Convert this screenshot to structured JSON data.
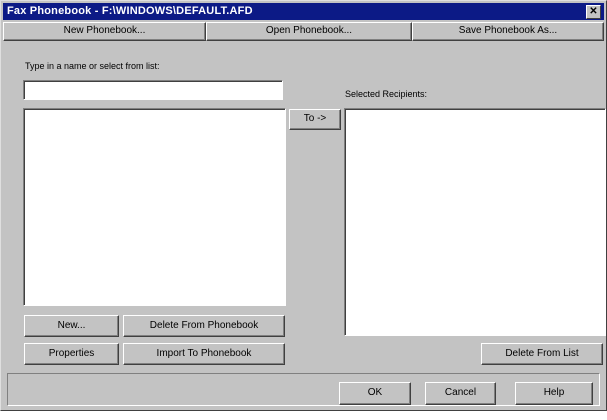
{
  "window": {
    "title": "Fax Phonebook - F:\\WINDOWS\\DEFAULT.AFD",
    "close_glyph": "✕"
  },
  "toolbar": {
    "new_phonebook": "New Phonebook...",
    "open_phonebook": "Open Phonebook...",
    "save_phonebook_as": "Save Phonebook As..."
  },
  "left": {
    "prompt": "Type in a name or select from list:",
    "name_input_value": "",
    "new_label": "New...",
    "delete_from_phonebook_label": "Delete From Phonebook",
    "properties_label": "Properties",
    "import_label": "Import To Phonebook"
  },
  "middle": {
    "to_label": "To ->"
  },
  "right": {
    "selected_label": "Selected Recipients:",
    "delete_from_list_label": "Delete From List"
  },
  "footer": {
    "ok_label": "OK",
    "cancel_label": "Cancel",
    "help_label": "Help"
  }
}
